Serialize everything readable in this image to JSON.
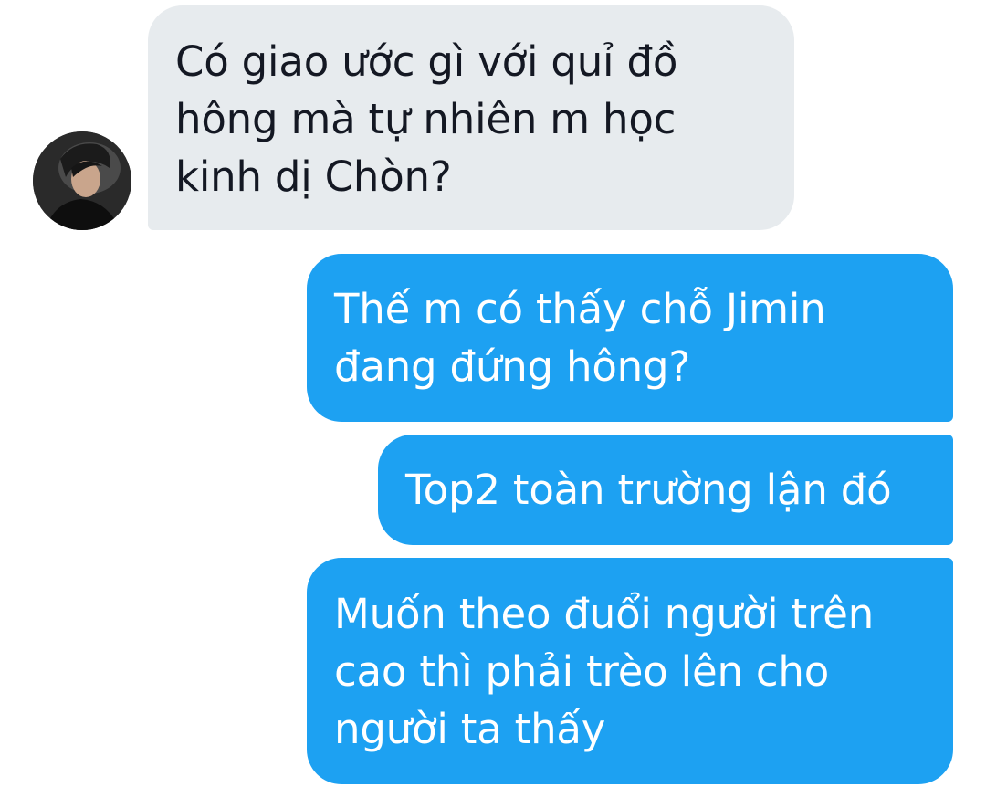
{
  "conversation": {
    "messages": [
      {
        "direction": "received",
        "text": "Có giao ước gì với quỉ đồ\nhông mà tự nhiên m học\nkinh dị Chòn?"
      },
      {
        "direction": "sent",
        "text": "Thế m có thấy chỗ Jimin\nđang đứng hông?"
      },
      {
        "direction": "sent",
        "text": "Top2 toàn trường lận đó"
      },
      {
        "direction": "sent",
        "text": "Muốn theo đuổi người trên\ncao thì phải trèo lên cho\nngười ta thấy"
      }
    ],
    "colors": {
      "received_bubble": "#e7ebee",
      "received_text": "#141823",
      "sent_bubble": "#1da1f2",
      "sent_text": "#ffffff"
    }
  }
}
